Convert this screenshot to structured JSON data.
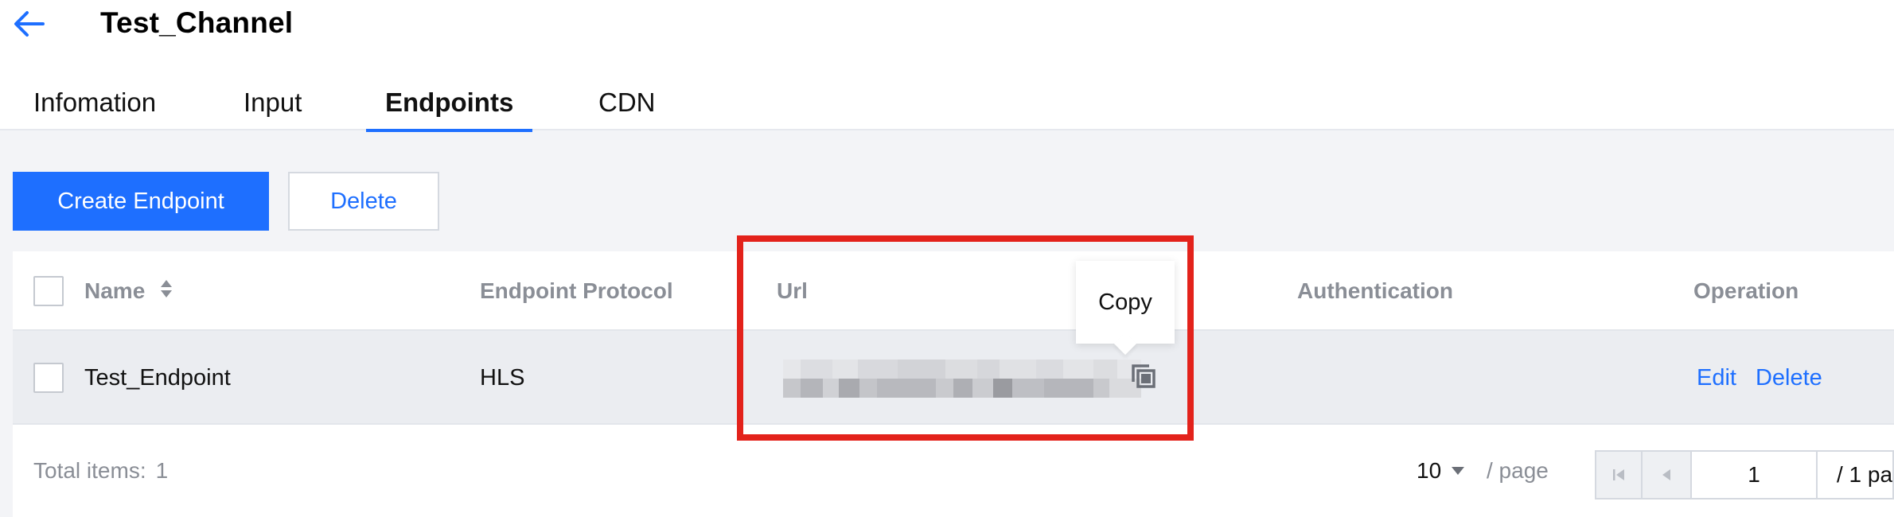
{
  "header": {
    "title": "Test_Channel",
    "back_icon": "arrow-left-icon"
  },
  "tabs": [
    {
      "label": "Infomation",
      "active": false
    },
    {
      "label": "Input",
      "active": false
    },
    {
      "label": "Endpoints",
      "active": true
    },
    {
      "label": "CDN",
      "active": false
    }
  ],
  "toolbar": {
    "create_label": "Create Endpoint",
    "delete_label": "Delete"
  },
  "table": {
    "columns": [
      "Name",
      "Endpoint Protocol",
      "Url",
      "Authentication",
      "Operation"
    ],
    "rows": [
      {
        "name": "Test_Endpoint",
        "protocol": "HLS",
        "url": "",
        "authentication": "",
        "operations": [
          "Edit",
          "Delete"
        ]
      }
    ]
  },
  "tooltip": {
    "text": "Copy"
  },
  "footer": {
    "total_label": "Total items:",
    "total_count": "1",
    "page_size": "10",
    "page_size_suffix": "/ page",
    "current_page": "1",
    "page_total": "/ 1 pa"
  },
  "colors": {
    "accent": "#1e6fff",
    "highlight": "#e3221b"
  }
}
